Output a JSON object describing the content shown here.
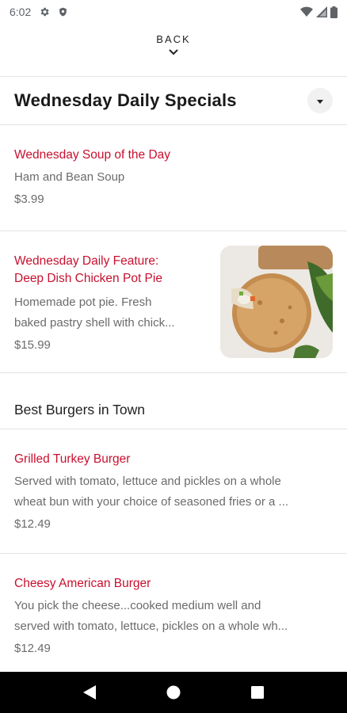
{
  "status_bar": {
    "time": "6:02",
    "icons": [
      "gear-icon",
      "shield-icon",
      "wifi-icon",
      "signal-icon",
      "battery-icon"
    ]
  },
  "back": {
    "label": "BACK",
    "icon": "chevron-down-icon"
  },
  "section": {
    "title": "Wednesday Daily Specials",
    "toggle_icon": "caret-down-icon"
  },
  "items": [
    {
      "name": "Wednesday Soup of the Day",
      "description": "Ham and Bean Soup",
      "price": "$3.99"
    },
    {
      "name_line1": "Wednesday Daily Feature:",
      "name_line2": "Deep Dish Chicken Pot Pie",
      "description_line1": "Homemade pot pie. Fresh",
      "description_line2": "baked pastry shell with chick...",
      "price": "$15.99",
      "image": "chicken-pot-pie-photo"
    }
  ],
  "subsection": {
    "title": "Best Burgers in Town"
  },
  "burgers": [
    {
      "name": "Grilled Turkey Burger",
      "description_line1": "Served with tomato, lettuce and pickles on a whole",
      "description_line2": "wheat bun with your choice of seasoned fries or a ...",
      "price": "$12.49"
    },
    {
      "name": "Cheesy American Burger",
      "description_line1": "You pick the cheese...cooked medium well and",
      "description_line2": "served with tomato, lettuce, pickles on a whole wh...",
      "price": "$12.49"
    }
  ],
  "nav_bar": {
    "icons": [
      "back-triangle-icon",
      "home-circle-icon",
      "recents-square-icon"
    ]
  },
  "colors": {
    "accent": "#c8102e",
    "text": "#1a1a1a",
    "muted": "#6b6b6b",
    "divider": "#e3e3e3"
  }
}
